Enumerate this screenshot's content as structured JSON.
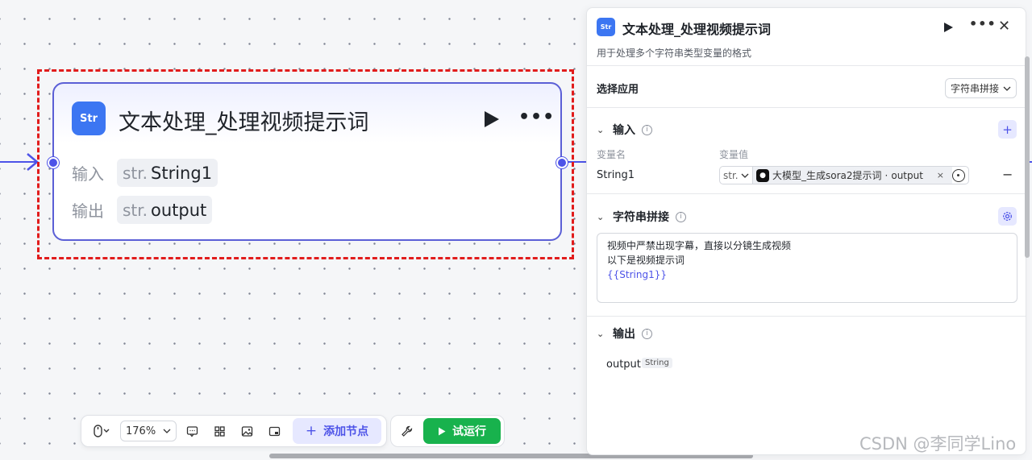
{
  "node": {
    "icon_label": "Str",
    "title": "文本处理_处理视频提示词",
    "input_label": "输入",
    "input_type": "str.",
    "input_value": "String1",
    "output_label": "输出",
    "output_type": "str.",
    "output_value": "output"
  },
  "toolbar": {
    "zoom": "176%",
    "add_node_label": "添加节点",
    "run_label": "试运行"
  },
  "panel": {
    "icon_label": "Str",
    "title": "文本处理_处理视频提示词",
    "description": "用于处理多个字符串类型变量的格式",
    "select_app_label": "选择应用",
    "select_app_value": "字符串拼接",
    "input_section": {
      "title": "输入",
      "col_name": "变量名",
      "col_value": "变量值",
      "variable_name": "String1",
      "variable_type": "str.",
      "variable_ref": "大模型_生成sora2提示词",
      "variable_ref_field": "output"
    },
    "concat_section": {
      "title": "字符串拼接",
      "line1": "视频中严禁出现字幕，直接以分镜生成视频",
      "line2": "以下是视频提示词",
      "line3": "{{String1}}"
    },
    "output_section": {
      "title": "输出",
      "name": "output",
      "type": "String"
    }
  },
  "watermark": "CSDN @李同学Lino",
  "colors": {
    "accent": "#4d53e8",
    "selection": "#e11c1c",
    "run": "#18b24d",
    "node_icon": "#3c76f2"
  }
}
